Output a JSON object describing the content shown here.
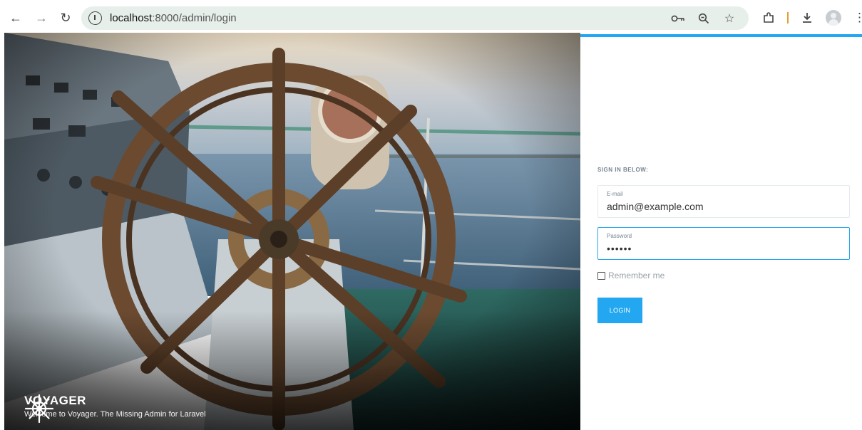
{
  "browser": {
    "url_host": "localhost",
    "url_path": ":8000/admin/login"
  },
  "brand": {
    "title": "VOYAGER",
    "subtitle": "Welcome to Voyager. The Missing Admin for Laravel"
  },
  "login": {
    "heading": "SIGN IN BELOW:",
    "email_label": "E-mail",
    "email_value": "admin@example.com",
    "password_label": "Password",
    "password_value": "••••••",
    "remember_label": "Remember me",
    "login_button": "LOGIN"
  },
  "colors": {
    "accent": "#22a7f0",
    "omnibox": "#e6efea"
  }
}
